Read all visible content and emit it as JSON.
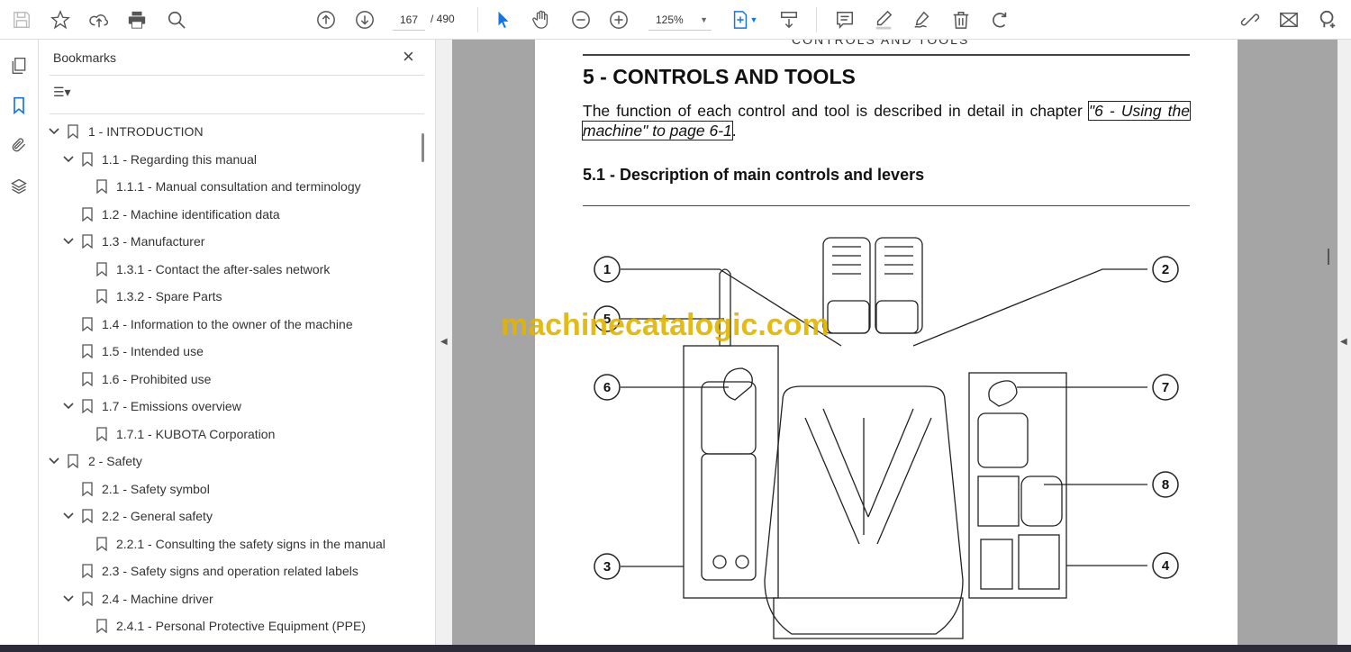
{
  "toolbar": {
    "page_current": "167",
    "page_total": "/ 490",
    "zoom": "125%"
  },
  "panel": {
    "title": "Bookmarks",
    "close": "×",
    "options": "☰▾"
  },
  "bookmarks": [
    {
      "label": "1  -  INTRODUCTION",
      "level": 0,
      "caret": true
    },
    {
      "label": "1.1 - Regarding this manual",
      "level": 1,
      "caret": true
    },
    {
      "label": "1.1.1 - Manual consultation and terminology",
      "level": 2,
      "caret": false
    },
    {
      "label": "1.2 - Machine identification data",
      "level": 1,
      "caret": false
    },
    {
      "label": "1.3 - Manufacturer",
      "level": 1,
      "caret": true
    },
    {
      "label": "1.3.1 - Contact the after-sales network",
      "level": 2,
      "caret": false
    },
    {
      "label": "1.3.2 - Spare Parts",
      "level": 2,
      "caret": false
    },
    {
      "label": "1.4 - Information to the owner of the machine",
      "level": 1,
      "caret": false
    },
    {
      "label": "1.5 - Intended use",
      "level": 1,
      "caret": false
    },
    {
      "label": "1.6 - Prohibited use",
      "level": 1,
      "caret": false
    },
    {
      "label": "1.7 - Emissions overview",
      "level": 1,
      "caret": true
    },
    {
      "label": "1.7.1 - KUBOTA Corporation",
      "level": 2,
      "caret": false
    },
    {
      "label": "2  -  Safety",
      "level": 0,
      "caret": true
    },
    {
      "label": "2.1 - Safety symbol",
      "level": 1,
      "caret": false
    },
    {
      "label": "2.2 - General safety",
      "level": 1,
      "caret": true
    },
    {
      "label": "2.2.1 - Consulting the safety signs in the manual",
      "level": 2,
      "caret": false
    },
    {
      "label": "2.3 - Safety signs and operation related labels",
      "level": 1,
      "caret": false
    },
    {
      "label": "2.4 - Machine driver",
      "level": 1,
      "caret": true
    },
    {
      "label": "2.4.1 - Personal Protective Equipment (PPE)",
      "level": 2,
      "caret": false
    }
  ],
  "document": {
    "running_header": "CONTROLS AND TOOLS",
    "heading": "5  -  CONTROLS AND TOOLS",
    "para_before": "The function of each control and tool is described in detail in chapter ",
    "para_link": "\"6 - Using the machine\" to page 6-1",
    "para_after": ".",
    "subheading": "5.1 - Description of main controls and levers",
    "callouts": [
      "1",
      "2",
      "3",
      "4",
      "5",
      "6",
      "7",
      "8"
    ],
    "watermark": "machinecatalogic.com"
  }
}
